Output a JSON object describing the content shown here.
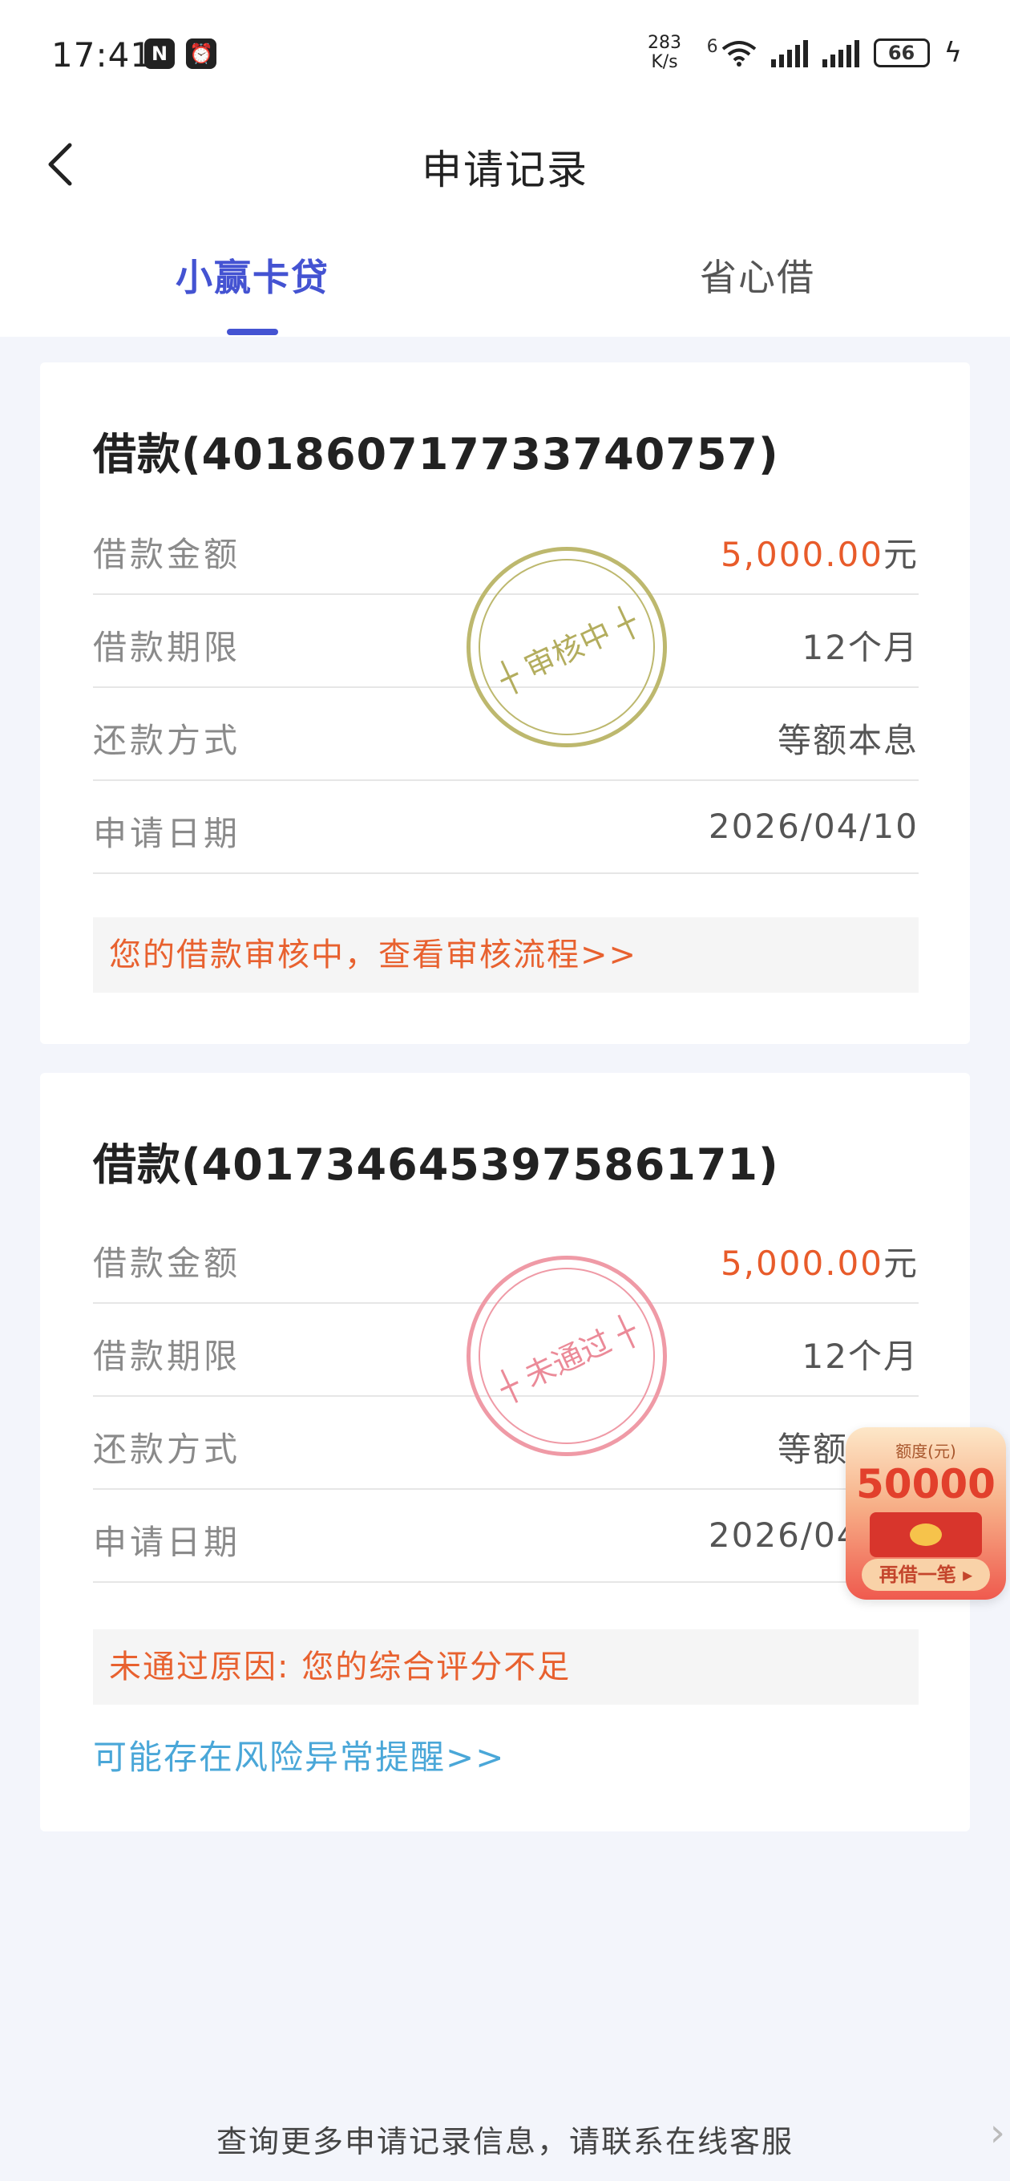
{
  "status_bar": {
    "time": "17:41",
    "net_speed_value": "283",
    "net_speed_unit": "K/s",
    "network_type": "6",
    "battery": "66"
  },
  "header": {
    "title": "申请记录"
  },
  "tabs": [
    {
      "label": "小赢卡贷",
      "active": true
    },
    {
      "label": "省心借",
      "active": false
    }
  ],
  "records": [
    {
      "title": "借款(401860717733740757)",
      "rows": [
        {
          "label": "借款金额",
          "amount": "5,000.00",
          "unit": "元"
        },
        {
          "label": "借款期限",
          "value": "12个月"
        },
        {
          "label": "还款方式",
          "value": "等额本息"
        },
        {
          "label": "申请日期",
          "value": "2026/04/10"
        }
      ],
      "stamp": "┼ 审核中 ┼",
      "notice": "您的借款审核中，查看审核流程>>"
    },
    {
      "title": "借款(401734645397586171)",
      "rows": [
        {
          "label": "借款金额",
          "amount": "5,000.00",
          "unit": "元"
        },
        {
          "label": "借款期限",
          "value": "12个月"
        },
        {
          "label": "还款方式",
          "value": "等额本息"
        },
        {
          "label": "申请日期",
          "value": "2026/04/10"
        }
      ],
      "stamp": "┼ 未通过 ┼",
      "notice": "未通过原因: 您的综合评分不足",
      "link": "可能存在风险异常提醒>>"
    }
  ],
  "promo": {
    "label": "额度(元)",
    "amount": "50000",
    "button": "再借一笔 ▸"
  },
  "footer": {
    "text": "查询更多申请记录信息，请联系在线客服"
  },
  "colors": {
    "accent": "#4453d2",
    "amount": "#e85b2a",
    "notice": "#e8612f",
    "link": "#4aa7d8",
    "stamp_review": "#bdb86e",
    "stamp_reject": "#ef9aa6"
  }
}
